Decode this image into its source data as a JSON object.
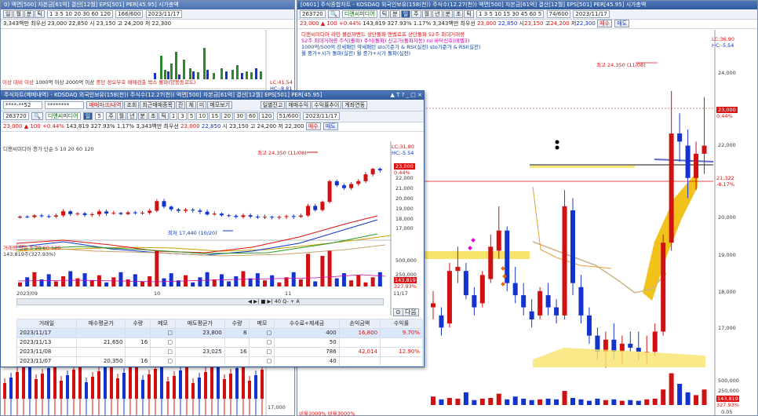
{
  "bg_window": {
    "title_left": "0)  액면[500]  자본금[61억]  결산[12월]  EPS[501]  PER[45.95]  시가총액",
    "price_line": "3,343백만 최우선  23,000  22,850  시 23,150  고 24,200  저 22,300",
    "legend": [
      "이상",
      "대비 이상",
      "1000억 이상",
      "2000억 이상",
      "종단",
      "정오부호",
      "매매검출",
      "박스 돌파(양봉동꼬도)"
    ],
    "lc": "LC:41.54",
    "hc": "HC:-8.81",
    "ylabel_17000": "17,000"
  },
  "right_window": {
    "title": "[0601] 주식종합차트 - KOSDAQ 외국인보유(158(천)) 주식수(12.27(천)) 액면[500] 자본금[61억] 결산[12월] EPS[501] PER[45.95] 시가총액",
    "toolbar": {
      "code": "263720",
      "name": "디앤씨미디어",
      "tabs": [
        "틱",
        "분",
        "일",
        "주",
        "월",
        "년",
        "분",
        "초",
        "틱"
      ],
      "intervals": [
        "1",
        "3",
        "5",
        "10",
        "15",
        "30",
        "45",
        "60",
        "5"
      ],
      "count": "74/600",
      "date": "2023/11/17"
    },
    "price": {
      "current": "23,000",
      "change": "▲ 100",
      "change_pct": "+0.44%",
      "volume": "143,819",
      "vol_ratio": "327.93%",
      "turnover": "1.17%",
      "amount": "3,343백만",
      "best": "최우선",
      "ask": "23,000",
      "bid": "22,850",
      "open_label": "시",
      "open": "23,150",
      "high_label": "고",
      "high": "24,200",
      "low_label": "저",
      "low": "22,300",
      "buy": "매수",
      "sell": "매도"
    },
    "legend_lines": [
      "디앤씨미디어   라인   볼린저밴드 상단돌파   엔벨로프 상단돌파   52주 최대거래량",
      "52주 최대거래량   주식(돌파)   주식(돌파)   신고가(돌파자동)   rsi 바닥신호(레벨3)",
      "1000억/500억 강세패턴   약세패턴   sto기준가 & RSI(실전)   sto기준가 & RSI(실전)",
      "월 중가+시가 돌파(실전)   월 중가+시가 돌파(실전)"
    ],
    "lc": "LC:36.90",
    "hc": "HC:-5.54",
    "high_note": "최고 24,350 (11/08)",
    "y_labels": [
      "24,000",
      "22,000",
      "20,000",
      "19,000",
      "18,000",
      "17,000"
    ],
    "current_tag": "23,000",
    "current_pct": "0.44%",
    "avg_tag": "21,322",
    "avg_pct": "-8.17%",
    "vol_labels": [
      "500,000",
      "250,000"
    ],
    "vol_current": "143,819",
    "vol_pct": "327.93%",
    "bottom_legend": "비율3000%  비율3000%",
    "bottom_right": "0.05"
  },
  "front_window": {
    "title": "주식차트(메매내역) - KOSDAQ 외국인보유(158(천)) 주식수(12.27(천)) 액면[500] 자본금[61억] 결산[12월] EPS[501] PER[45.95]",
    "account": "****-**52",
    "password": "********",
    "tabs": [
      "매매마크/내역",
      "조회",
      "최근매매종목",
      "잔",
      "체",
      "미",
      "메모보기"
    ],
    "right_tabs": [
      "일별잔고",
      "매매수익",
      "수익률추이",
      "계좌연동"
    ],
    "code": "263720",
    "name": "디앤씨미디어",
    "period": "일",
    "period_n": "5",
    "intervals": [
      "주",
      "월",
      "년",
      "분",
      "초",
      "틱",
      "1",
      "3",
      "5",
      "10",
      "15",
      "20",
      "30",
      "60",
      "120"
    ],
    "count": "51/600",
    "date": "2023/11/17",
    "price": {
      "current": "23,000",
      "change": "▲ 100",
      "change_pct": "+0.44%",
      "volume": "143,819",
      "vol_ratio": "327.93%",
      "turnover": "1.17%",
      "amount": "3,343백만",
      "best": "최우선",
      "ask": "23,000",
      "bid": "22,850",
      "open": "시 23,150",
      "high": "고 24,200",
      "low": "저 22,300",
      "buy": "매수",
      "sell": "매도"
    },
    "legend": "디앤씨미디어   종가 단순 5 10 20 60 120",
    "lc": "LC:31.80",
    "hc": "HC:-5.54",
    "high_note": "최고 24,350 (11/08)",
    "low_note": "최저 17,440 (10/20)",
    "y_labels": [
      "23,000",
      "22,000",
      "21,000",
      "20,000",
      "19,000",
      "18,000",
      "17,000"
    ],
    "current_tag": "23,000",
    "current_pct": "0.44%",
    "vol_legend": "거래량 단순 5 20 60 120",
    "vol_value": "143,819주(327.93%)",
    "vol_labels": [
      "500,000",
      "250,000"
    ],
    "vol_current": "143,819",
    "vol_pct": "327.93%",
    "x_labels": [
      "2023/09",
      "10",
      "11"
    ],
    "x_end": "11/17",
    "zoom": "40",
    "next_btn": "다음",
    "table": {
      "headers": [
        "거래일",
        "매수평균가",
        "수량",
        "메모",
        "매도평균가",
        "수량",
        "메모",
        "수수료+제세금",
        "손익금액",
        "수익률"
      ],
      "rows": [
        [
          "2023/11/17",
          "",
          "",
          "",
          "23,800",
          "8",
          "",
          "400",
          "16,800",
          "9.70%"
        ],
        [
          "2023/11/13",
          "21,650",
          "16",
          "",
          "",
          "",
          "",
          "50",
          "",
          ""
        ],
        [
          "2023/11/08",
          "",
          "",
          "",
          "23,025",
          "16",
          "",
          "786",
          "42,014",
          "12.90%"
        ],
        [
          "2023/11/07",
          "20,350",
          "16",
          "",
          "",
          "",
          "",
          "40",
          "",
          ""
        ]
      ]
    }
  },
  "colors": {
    "up": "#d11111",
    "down": "#1433cc",
    "title": "#2f5a9c"
  }
}
